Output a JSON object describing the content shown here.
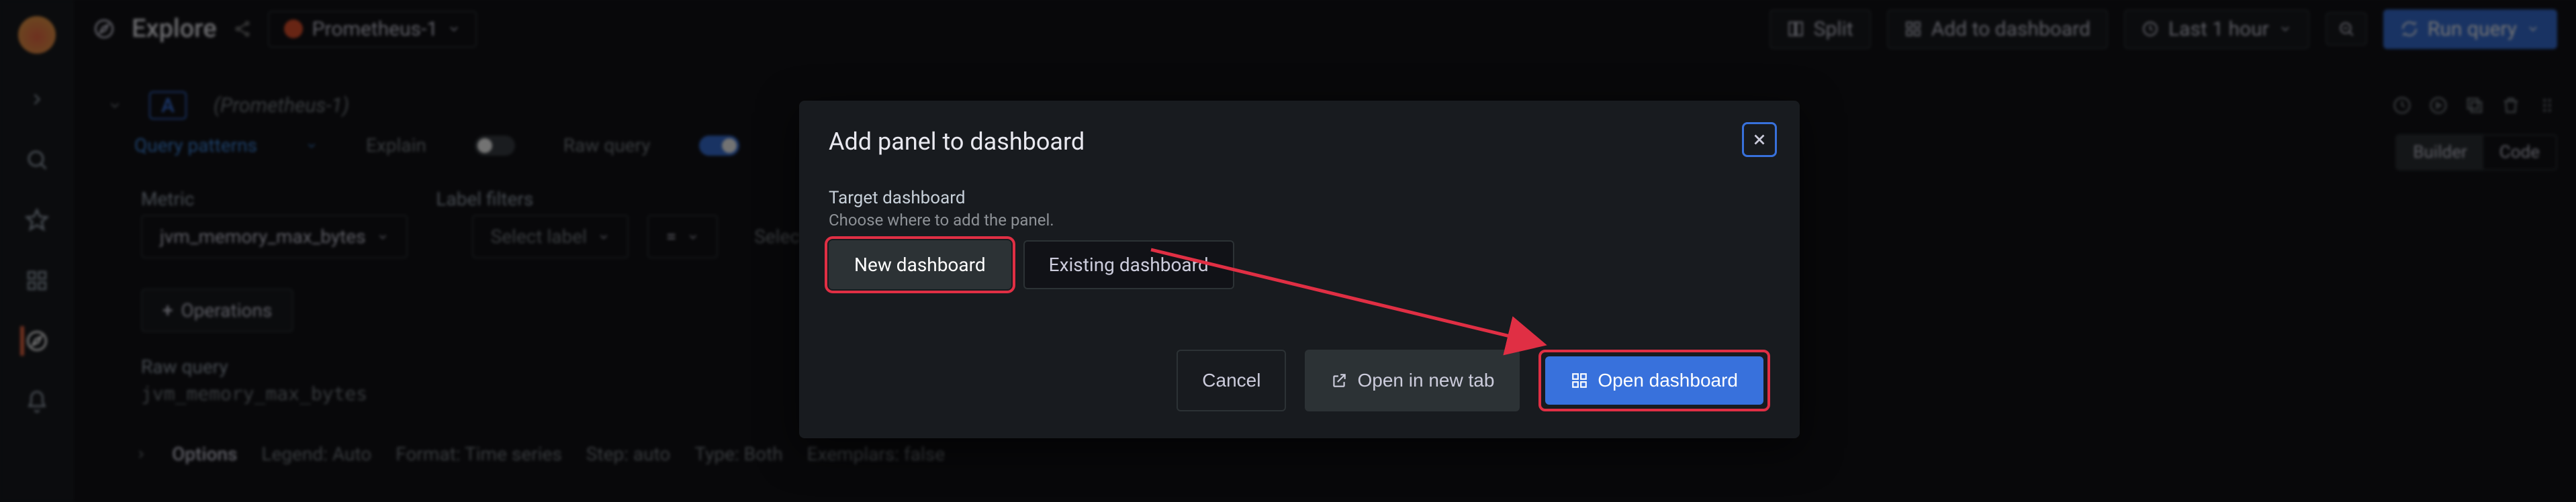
{
  "colors": {
    "accent_blue": "#3871dc",
    "accent_red": "#e02f44",
    "bg_panel": "#181b1f"
  },
  "sidebar": {
    "items": [
      {
        "name": "logo",
        "icon": "grafana-logo"
      },
      {
        "name": "expand",
        "icon": "chevron-right-icon"
      },
      {
        "name": "search",
        "icon": "search-icon"
      },
      {
        "name": "starred",
        "icon": "star-icon"
      },
      {
        "name": "dashboards",
        "icon": "apps-icon"
      },
      {
        "name": "explore",
        "icon": "compass-icon",
        "active": true
      },
      {
        "name": "alerting",
        "icon": "bell-icon"
      }
    ]
  },
  "topbar": {
    "compass_icon": "compass-icon",
    "title": "Explore",
    "share_icon": "share-icon",
    "datasource": {
      "logo": "prometheus-logo",
      "name": "Prometheus-1"
    },
    "split_label": "Split",
    "add_to_dash_label": "Add to dashboard",
    "time": {
      "label": "Last 1 hour"
    },
    "run_query_label": "Run query"
  },
  "query_editor": {
    "query_letter": "A",
    "datasource_hint": "(Prometheus-1)",
    "patterns_label": "Query patterns",
    "explain_label": "Explain",
    "raw_label": "Raw query",
    "mode_builder": "Builder",
    "mode_code": "Code",
    "metric_label": "Metric",
    "metric_value": "jvm_memory_max_bytes",
    "labelfilters_label": "Label filters",
    "labelfilters_placeholder_label": "Select label",
    "labelfilters_op": "=",
    "labelfilters_placeholder_value": "Select value",
    "operations_label": "Operations",
    "rawquery_label": "Raw query",
    "rawquery_value": "jvm_memory_max_bytes",
    "options_label": "Options",
    "options_summary": {
      "legend": "Legend: Auto",
      "format": "Format: Time series",
      "step": "Step: auto",
      "type": "Type: Both",
      "exemplars": "Exemplars: false"
    }
  },
  "modal": {
    "title": "Add panel to dashboard",
    "target_label": "Target dashboard",
    "target_desc": "Choose where to add the panel.",
    "option_new": "New dashboard",
    "option_existing": "Existing dashboard",
    "cancel": "Cancel",
    "open_new_tab": "Open in new tab",
    "open_dashboard": "Open dashboard"
  }
}
